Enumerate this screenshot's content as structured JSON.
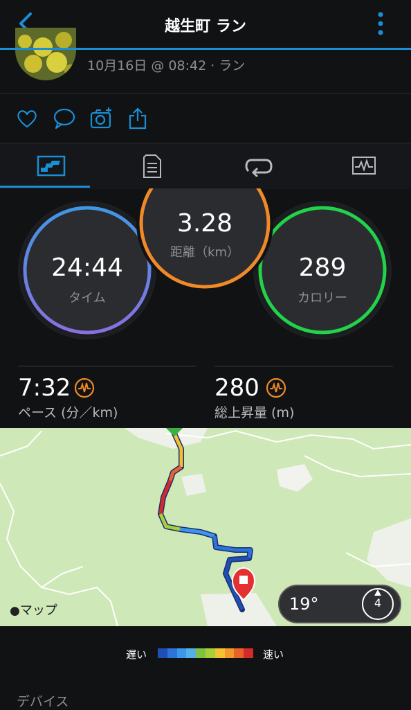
{
  "header": {
    "title": "越生町 ラン",
    "back_icon": "chevron-left-icon",
    "more_icon": "vertical-ellipsis-icon"
  },
  "activity": {
    "date_line": "10月16日 @ 08:42 · ラン"
  },
  "social": {
    "icons": [
      "heart-icon",
      "comment-icon",
      "camera-add-icon",
      "share-icon"
    ]
  },
  "tabs": [
    {
      "icon": "summary-chart-icon",
      "active": true
    },
    {
      "icon": "details-list-icon",
      "active": false
    },
    {
      "icon": "laps-loop-icon",
      "active": false
    },
    {
      "icon": "graph-monitor-icon",
      "active": false
    }
  ],
  "circles": {
    "time": {
      "value": "24:44",
      "label": "タイム"
    },
    "distance": {
      "value": "3.28",
      "label": "距離（km）"
    },
    "calories": {
      "value": "289",
      "label": "カロリー"
    }
  },
  "stats": {
    "pace": {
      "value": "7:32",
      "label": "ペース (分／km)"
    },
    "ascent": {
      "value": "280",
      "label": "総上昇量 (m)"
    }
  },
  "map": {
    "provider_label": "マップ",
    "temperature": "19°",
    "wind_speed": "4"
  },
  "legend": {
    "slow": "遅い",
    "fast": "速い",
    "colors": [
      "#1f4fb4",
      "#2d74d8",
      "#3c97e8",
      "#56b0e8",
      "#7fc241",
      "#a8cf3a",
      "#f2c230",
      "#f09a2a",
      "#e8632a",
      "#d52a2a"
    ]
  },
  "section": {
    "device_title": "デバイス"
  },
  "colors": {
    "accent": "#1a8fd6",
    "time_ring": "#4a8fe0",
    "distance_ring": "#f08a28",
    "calories_ring": "#22d24a"
  }
}
